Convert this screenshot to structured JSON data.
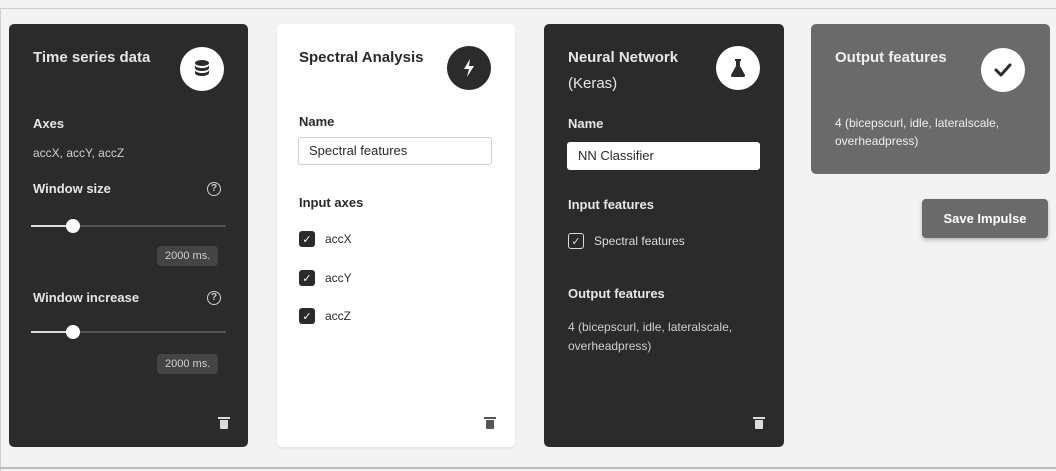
{
  "cards": {
    "time_series": {
      "title": "Time series data",
      "icon": "database-icon",
      "axes_label": "Axes",
      "axes_value": "accX, accY, accZ",
      "window_size_label": "Window size",
      "window_size_value": "2000 ms.",
      "window_increase_label": "Window increase",
      "window_increase_value": "2000 ms.",
      "help_glyph": "?"
    },
    "spectral": {
      "title": "Spectral Analysis",
      "icon": "lightning-icon",
      "name_label": "Name",
      "name_value": "Spectral features",
      "input_axes_label": "Input axes",
      "axes": [
        {
          "label": "accX",
          "checked": true
        },
        {
          "label": "accY",
          "checked": true
        },
        {
          "label": "accZ",
          "checked": true
        }
      ]
    },
    "neural_network": {
      "title_line1": "Neural Network",
      "title_line2": "(Keras)",
      "icon": "flask-icon",
      "name_label": "Name",
      "name_value": "NN Classifier",
      "input_features_label": "Input features",
      "input_feature": "Spectral features",
      "output_features_label": "Output features",
      "output_line1": "4 (bicepscurl, idle, lateralscale,",
      "output_line2": "overheadpress)"
    },
    "output": {
      "title": "Output features",
      "icon": "checkmark-icon",
      "line1": "4 (bicepscurl, idle, lateralscale,",
      "line2": "overheadpress)"
    }
  },
  "save_button_label": "Save Impulse",
  "colors": {
    "dark_card": "#2b2b2b",
    "grey_card": "#6a6a6a",
    "light_card": "#ffffff",
    "background": "#f3f3f3"
  }
}
